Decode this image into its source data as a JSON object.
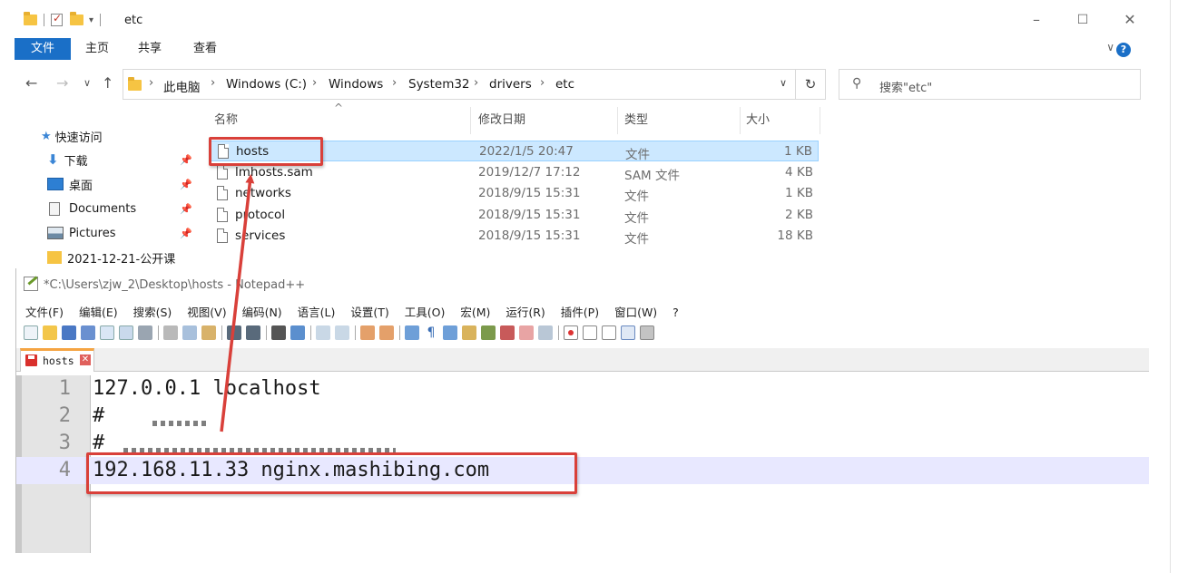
{
  "explorer": {
    "title": "etc",
    "ribbon_tabs": [
      "文件",
      "主页",
      "共享",
      "查看"
    ],
    "breadcrumbs": [
      "此电脑",
      "Windows (C:)",
      "Windows",
      "System32",
      "drivers",
      "etc"
    ],
    "search_placeholder": "搜索\"etc\"",
    "nav_items": [
      {
        "label": "快速访问",
        "icon": "star-icon"
      },
      {
        "label": "下载",
        "icon": "download-icon",
        "pinned": true
      },
      {
        "label": "桌面",
        "icon": "desktop-icon",
        "pinned": true
      },
      {
        "label": "Documents",
        "icon": "documents-icon",
        "pinned": true
      },
      {
        "label": "Pictures",
        "icon": "pictures-icon",
        "pinned": true
      },
      {
        "label": "2021-12-21-公开课",
        "icon": "folder-icon"
      }
    ],
    "columns": [
      "名称",
      "修改日期",
      "类型",
      "大小"
    ],
    "files": [
      {
        "name": "hosts",
        "date": "2022/1/5 20:47",
        "type": "文件",
        "size": "1 KB",
        "selected": true
      },
      {
        "name": "lmhosts.sam",
        "date": "2019/12/7 17:12",
        "type": "SAM 文件",
        "size": "4 KB"
      },
      {
        "name": "networks",
        "date": "2018/9/15 15:31",
        "type": "文件",
        "size": "1 KB"
      },
      {
        "name": "protocol",
        "date": "2018/9/15 15:31",
        "type": "文件",
        "size": "2 KB"
      },
      {
        "name": "services",
        "date": "2018/9/15 15:31",
        "type": "文件",
        "size": "18 KB"
      }
    ]
  },
  "notepad": {
    "title": "*C:\\Users\\zjw_2\\Desktop\\hosts - Notepad++",
    "menu": [
      "文件(F)",
      "编辑(E)",
      "搜索(S)",
      "视图(V)",
      "编码(N)",
      "语言(L)",
      "设置(T)",
      "工具(O)",
      "宏(M)",
      "运行(R)",
      "插件(P)",
      "窗口(W)",
      "?"
    ],
    "tab_label": "hosts",
    "lines": [
      {
        "num": "1",
        "text": "127.0.0.1 localhost"
      },
      {
        "num": "2",
        "text": "#"
      },
      {
        "num": "3",
        "text": "#"
      },
      {
        "num": "4",
        "text": "192.168.11.33 nginx.mashibing.com"
      }
    ]
  },
  "colors": {
    "accent": "#1a6fc7",
    "selection": "#cce8ff",
    "annotation": "#d9403a",
    "current_line": "#e8e8ff"
  }
}
